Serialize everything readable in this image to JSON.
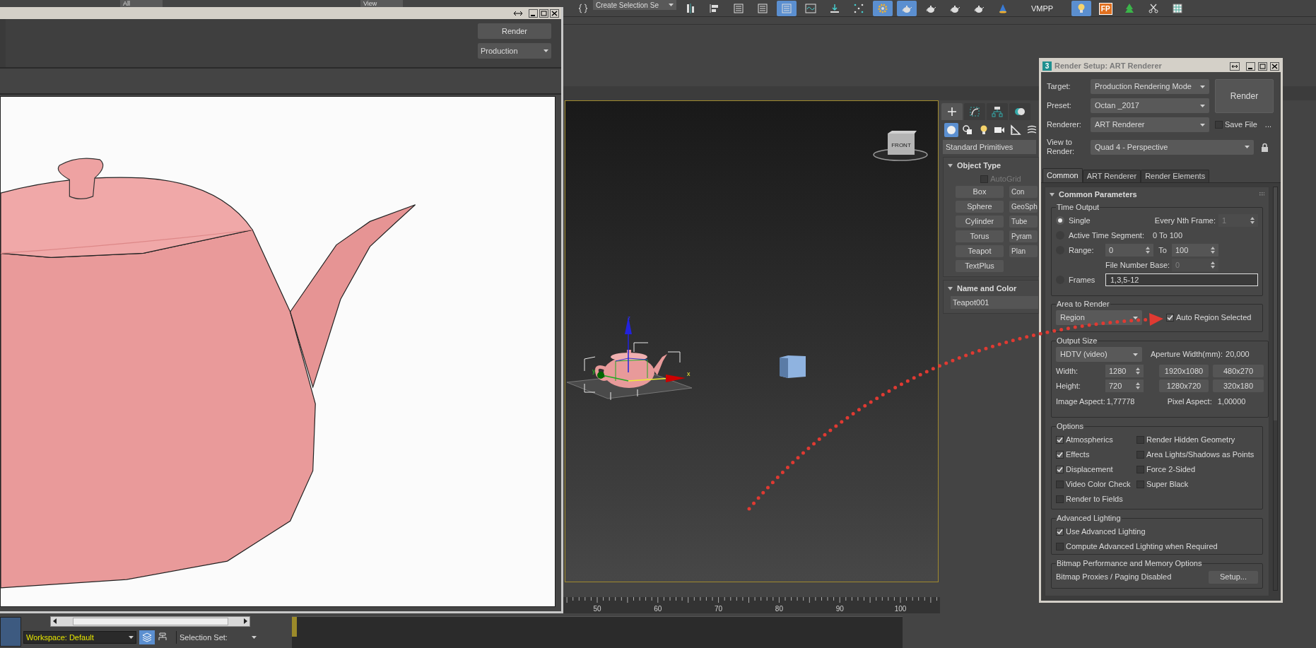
{
  "top_toolbar": {
    "left_dropdowns": [
      "All",
      "View"
    ],
    "selection_set_dropdown": "Create Selection Se",
    "tools": [
      {
        "kind": "bars",
        "active": false
      },
      {
        "kind": "align",
        "active": false
      },
      {
        "kind": "list",
        "active": false
      },
      {
        "kind": "list",
        "active": false
      },
      {
        "kind": "list",
        "active": true
      },
      {
        "kind": "wave",
        "active": false
      },
      {
        "kind": "download",
        "active": false
      },
      {
        "kind": "dots",
        "active": false
      },
      {
        "kind": "gear",
        "active": true
      },
      {
        "kind": "teapot",
        "active": true
      },
      {
        "kind": "teapot",
        "active": false
      },
      {
        "kind": "teapot",
        "active": false
      },
      {
        "kind": "teapot",
        "active": false
      },
      {
        "kind": "cone",
        "active": false
      }
    ],
    "label": "VMPP",
    "tools_after_label": [
      {
        "kind": "bulb",
        "active": true
      },
      {
        "kind": "badge",
        "text": "FP",
        "active": false
      },
      {
        "kind": "tree",
        "active": false
      },
      {
        "kind": "scissors",
        "active": false
      },
      {
        "kind": "grid",
        "active": false
      }
    ]
  },
  "frame_window": {
    "render_button": "Render",
    "target_dropdown": "Production"
  },
  "viewport": {
    "axis_labels": {
      "x": "x",
      "y": "y",
      "z": "z"
    },
    "view_cube_label": "FRONT"
  },
  "command_panel": {
    "tabs": [
      {
        "kind": "plus",
        "selected": true
      },
      {
        "kind": "curve",
        "selected": false
      },
      {
        "kind": "hierarchy",
        "selected": false
      },
      {
        "kind": "motion",
        "selected": false
      }
    ],
    "categories": [
      {
        "kind": "sphere",
        "selected": true
      },
      {
        "kind": "shapes",
        "selected": false
      },
      {
        "kind": "bulb",
        "selected": false
      },
      {
        "kind": "camera",
        "selected": false
      },
      {
        "kind": "ruler",
        "selected": false
      },
      {
        "kind": "waves",
        "selected": false
      }
    ],
    "category_dropdown": "Standard Primitives",
    "object_type": {
      "title": "Object Type",
      "autogrid": {
        "label": "AutoGrid",
        "checked": false,
        "disabled": true
      },
      "buttons": [
        "Box",
        "Con",
        "Sphere",
        "GeoSph",
        "Cylinder",
        "Tube",
        "Torus",
        "Pyram",
        "Teapot",
        "Plan",
        "TextPlus"
      ]
    },
    "name_and_color": {
      "title": "Name and Color",
      "name_value": "Teapot001"
    }
  },
  "timeline": {
    "ticks": [
      "50",
      "60",
      "70",
      "80",
      "90",
      "100"
    ]
  },
  "status_bar": {
    "workspace": "Workspace: Default",
    "selection_set": "Selection Set:"
  },
  "render_setup": {
    "app_icon": "3",
    "title": "Render Setup: ART Renderer",
    "target": {
      "label": "Target:",
      "value": "Production Rendering Mode"
    },
    "preset": {
      "label": "Preset:",
      "value": "Octan _2017"
    },
    "renderer": {
      "label": "Renderer:",
      "value": "ART Renderer"
    },
    "save_file": {
      "label": "Save File",
      "checked": false
    },
    "browse_button": "...",
    "view_to_render": {
      "label": "View to Render:",
      "value": "Quad 4 - Perspective"
    },
    "render_button": "Render",
    "tabs": [
      {
        "label": "Common",
        "selected": true
      },
      {
        "label": "ART Renderer",
        "selected": false
      },
      {
        "label": "Render Elements",
        "selected": false
      }
    ],
    "rollout_title": "Common Parameters",
    "time_output": {
      "title": "Time Output",
      "options": [
        {
          "label": "Single",
          "selected": true
        },
        {
          "label": "Active Time Segment:",
          "selected": false
        },
        {
          "label": "Range:",
          "selected": false
        },
        {
          "label": "Frames",
          "selected": false
        }
      ],
      "every_nth": {
        "label": "Every Nth Frame:",
        "value": "1",
        "disabled": true
      },
      "active_segment_value": "0 To 100",
      "range_start": "0",
      "range_to_label": "To",
      "range_end": "100",
      "file_number_base": {
        "label": "File Number Base:",
        "value": "0",
        "disabled": true
      },
      "frames_value": "1,3,5-12"
    },
    "area_to_render": {
      "title": "Area to Render",
      "dropdown": "Region",
      "auto_region": {
        "label": "Auto Region Selected",
        "checked": true
      }
    },
    "output_size": {
      "title": "Output Size",
      "preset_dropdown": "HDTV (video)",
      "aperture_label": "Aperture Width(mm):",
      "aperture_value": "20,000",
      "width_label": "Width:",
      "width_value": "1280",
      "height_label": "Height:",
      "height_value": "720",
      "presets": [
        "1920x1080",
        "480x270",
        "1280x720",
        "320x180"
      ],
      "image_aspect_label": "Image Aspect:",
      "image_aspect_value": "1,77778",
      "pixel_aspect_label": "Pixel Aspect:",
      "pixel_aspect_value": "1,00000"
    },
    "options": {
      "title": "Options",
      "items": [
        {
          "label": "Atmospherics",
          "checked": true
        },
        {
          "label": "Render Hidden Geometry",
          "checked": false
        },
        {
          "label": "Effects",
          "checked": true
        },
        {
          "label": "Area Lights/Shadows as Points",
          "checked": false
        },
        {
          "label": "Displacement",
          "checked": true
        },
        {
          "label": "Force 2-Sided",
          "checked": false
        },
        {
          "label": "Video Color Check",
          "checked": false
        },
        {
          "label": "Super Black",
          "checked": false
        },
        {
          "label": "Render to Fields",
          "checked": false
        }
      ]
    },
    "advanced_lighting": {
      "title": "Advanced Lighting",
      "items": [
        {
          "label": "Use Advanced Lighting",
          "checked": true
        },
        {
          "label": "Compute Advanced Lighting when Required",
          "checked": false
        }
      ]
    },
    "bitmap": {
      "title": "Bitmap Performance and Memory Options",
      "status": "Bitmap Proxies / Paging Disabled",
      "setup_button": "Setup..."
    }
  }
}
